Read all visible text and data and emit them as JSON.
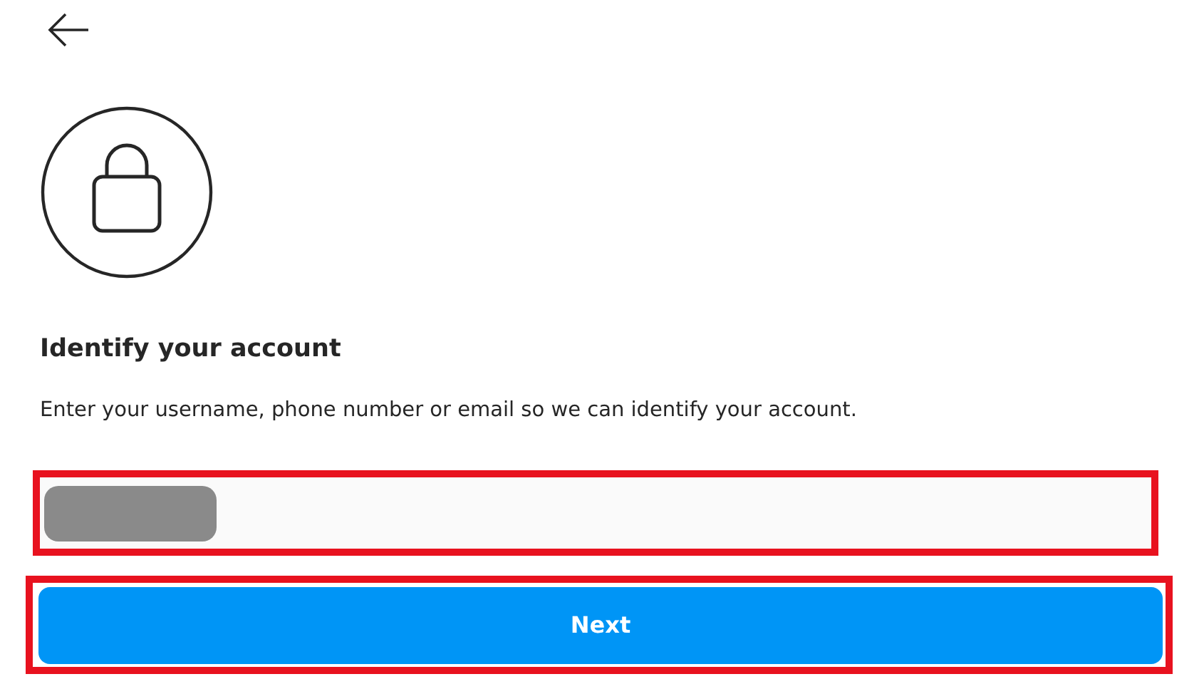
{
  "header": {
    "back_button": true
  },
  "title": "Identify your account",
  "instruction": "Enter your username, phone number or email so we can identify your account.",
  "username_field": {
    "redacted": true,
    "highlighted": true
  },
  "next_button": {
    "label": "Next",
    "highlighted": true
  }
}
